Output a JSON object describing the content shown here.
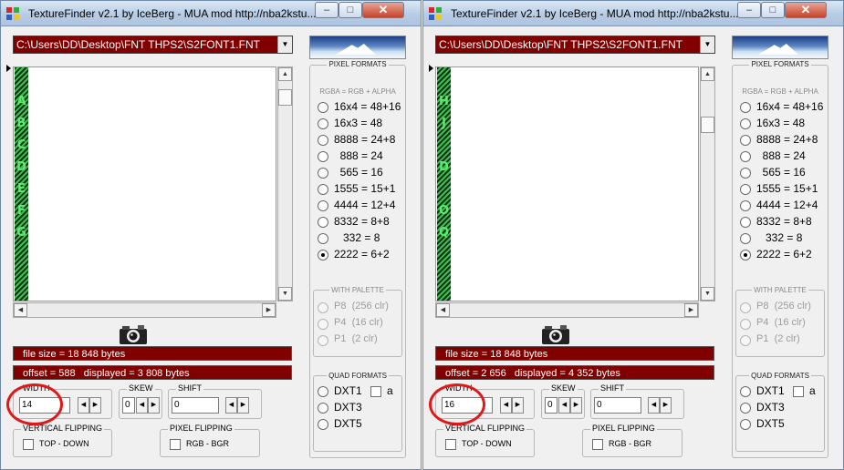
{
  "windows": [
    {
      "title": "TextureFinder v2.1 by IceBerg - MUA mod http://nba2kstu...",
      "path": "C:\\Users\\DD\\Desktop\\FNT THPS2\\S2FONT1.FNT",
      "glyphs": [
        "A",
        "B",
        "C",
        "D",
        "E",
        "F",
        "G"
      ],
      "file_size": "file size = 18 848 bytes",
      "offset": "offset = 588   displayed = 3 808 bytes",
      "width_label": "WIDTH",
      "width_value": "14",
      "skew_label": "SKEW",
      "skew_value": "0",
      "shift_label": "SHIFT",
      "shift_value": "0",
      "vflip_label": "VERTICAL FLIPPING",
      "vflip_option": "TOP - DOWN",
      "pflip_label": "PIXEL FLIPPING",
      "pflip_option": "RGB  -  BGR",
      "pixel_formats_label": "PIXEL FORMATS",
      "rgba_note": "RGBA = RGB + ALPHA",
      "formats": [
        "16x4 = 48+16",
        "16x3 = 48",
        "8888 = 24+8",
        "  888 = 24",
        "  565 = 16",
        "1555 = 15+1",
        "4444 = 12+4",
        "8332 = 8+8",
        "   332 = 8",
        "2222 = 6+2"
      ],
      "selected_format": "2222 = 6+2",
      "palette_label": "WITH PALETTE",
      "palette_formats": [
        "P8  (256 clr)",
        "P4  (16 clr)",
        "P1  (2 clr)"
      ],
      "quad_label": "QUAD FORMATS",
      "quad_formats": [
        "DXT1",
        "DXT3",
        "DXT5"
      ],
      "dxt1_alpha": "a"
    },
    {
      "title": "TextureFinder v2.1 by IceBerg - MUA mod http://nba2kstu...",
      "path": "C:\\Users\\DD\\Desktop\\FNT THPS2\\S2FONT1.FNT",
      "glyphs": [
        "H",
        "J",
        "",
        "D",
        "",
        "O",
        "Q"
      ],
      "file_size": "file size = 18 848 bytes",
      "offset": "offset = 2 656   displayed = 4 352 bytes",
      "width_label": "WIDTH",
      "width_value": "16",
      "skew_label": "SKEW",
      "skew_value": "0",
      "shift_label": "SHIFT",
      "shift_value": "0",
      "vflip_label": "VERTICAL FLIPPING",
      "vflip_option": "TOP - DOWN",
      "pflip_label": "PIXEL FLIPPING",
      "pflip_option": "RGB  -  BGR",
      "pixel_formats_label": "PIXEL FORMATS",
      "rgba_note": "RGBA = RGB + ALPHA",
      "formats": [
        "16x4 = 48+16",
        "16x3 = 48",
        "8888 = 24+8",
        "  888 = 24",
        "  565 = 16",
        "1555 = 15+1",
        "4444 = 12+4",
        "8332 = 8+8",
        "   332 = 8",
        "2222 = 6+2"
      ],
      "selected_format": "2222 = 6+2",
      "palette_label": "WITH PALETTE",
      "palette_formats": [
        "P8  (256 clr)",
        "P4  (16 clr)",
        "P1  (2 clr)"
      ],
      "quad_label": "QUAD FORMATS",
      "quad_formats": [
        "DXT1",
        "DXT3",
        "DXT5"
      ],
      "dxt1_alpha": "a"
    }
  ],
  "colors": {
    "path_bg": "#800000",
    "info_bg": "#800000",
    "glyph": "#5eea70",
    "annotation": "#e01818"
  }
}
